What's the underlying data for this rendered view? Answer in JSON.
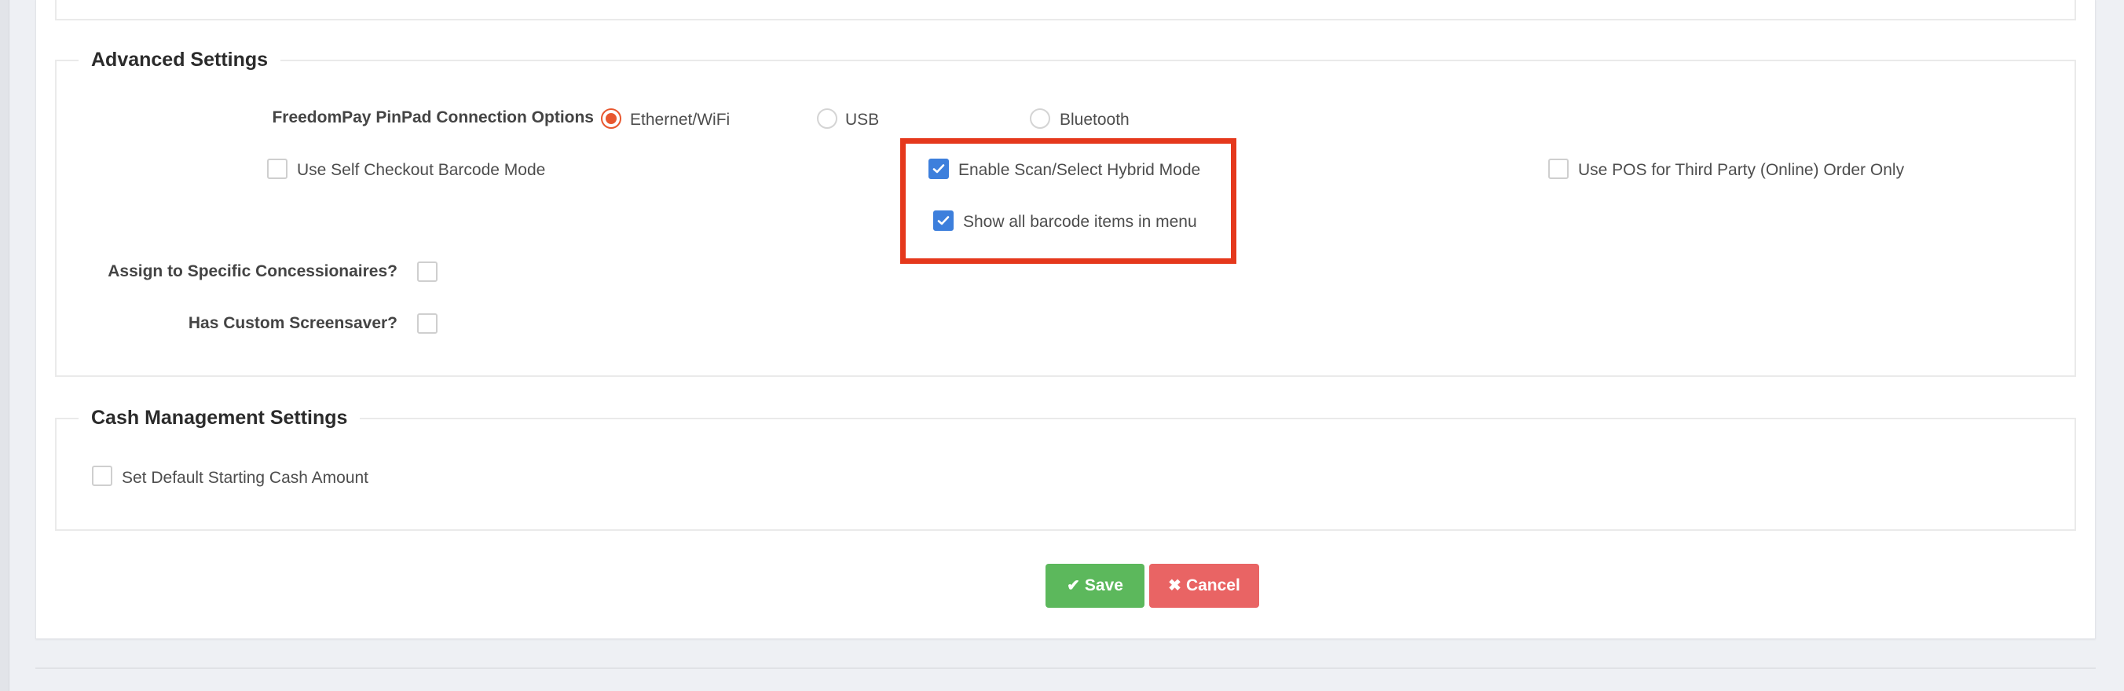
{
  "sections": {
    "advanced": {
      "title": "Advanced Settings",
      "pinpad_label": "FreedomPay PinPad Connection Options",
      "pinpad_options": [
        {
          "label": "Ethernet/WiFi",
          "selected": true
        },
        {
          "label": "USB",
          "selected": false
        },
        {
          "label": "Bluetooth",
          "selected": false
        }
      ],
      "self_checkout": {
        "label": "Use Self Checkout Barcode Mode",
        "checked": false
      },
      "hybrid_mode": {
        "label": "Enable Scan/Select Hybrid Mode",
        "checked": true
      },
      "show_barcode_items": {
        "label": "Show all barcode items in menu",
        "checked": true
      },
      "third_party": {
        "label": "Use POS for Third Party (Online) Order Only",
        "checked": false
      },
      "concessionaires": {
        "label": "Assign to Specific Concessionaires?",
        "checked": false
      },
      "screensaver": {
        "label": "Has Custom Screensaver?",
        "checked": false
      }
    },
    "cash": {
      "title": "Cash Management Settings",
      "default_cash": {
        "label": "Set Default Starting Cash Amount",
        "checked": false
      }
    }
  },
  "actions": {
    "save_label": "Save",
    "cancel_label": "Cancel"
  },
  "colors": {
    "accent_radio": "#e8572f",
    "checkbox_checked": "#3d7fdc",
    "highlight": "#e5381c",
    "save": "#5cb85c",
    "cancel": "#e96464"
  },
  "icons": {
    "save": "check-icon",
    "cancel": "times-icon"
  }
}
